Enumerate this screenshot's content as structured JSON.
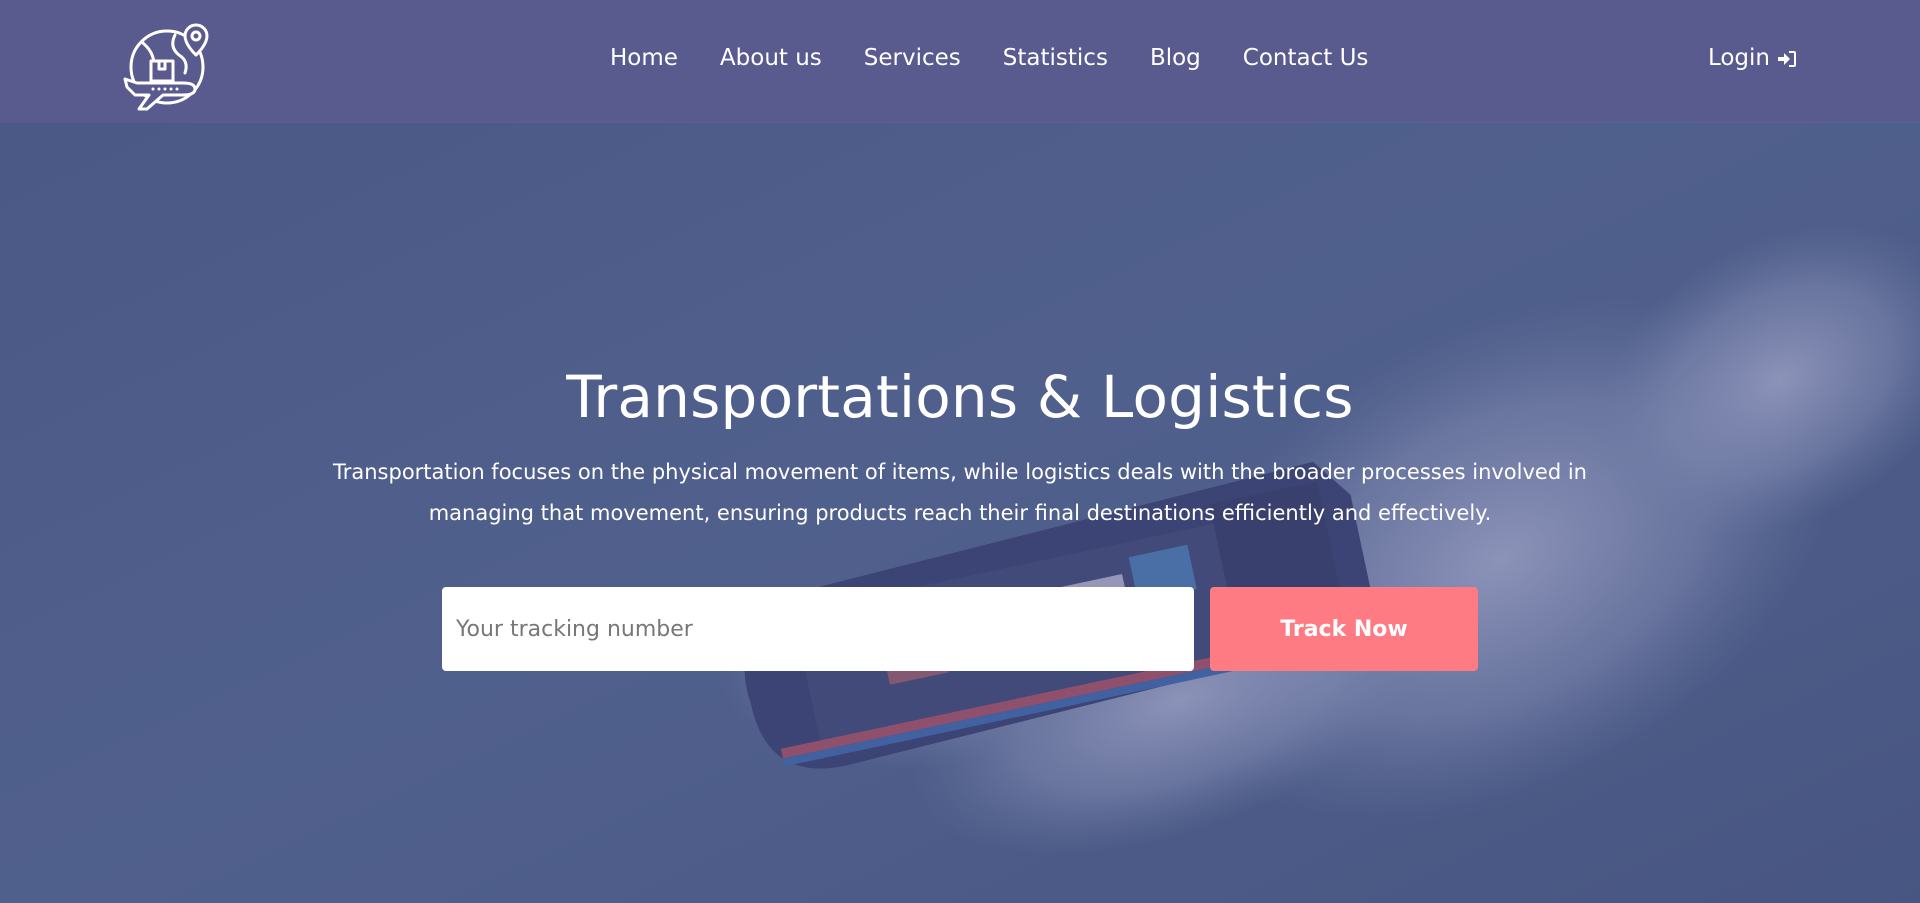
{
  "theme": {
    "navbar_bg": "#5a5a8e",
    "overlay": "#545592",
    "accent": "#fe7b84",
    "text": "#ffffff"
  },
  "header": {
    "logo_icon": "globe-plane-location-icon",
    "nav": [
      {
        "label": "Home"
      },
      {
        "label": "About us"
      },
      {
        "label": "Services"
      },
      {
        "label": "Statistics"
      },
      {
        "label": "Blog"
      },
      {
        "label": "Contact Us"
      }
    ],
    "login": {
      "label": "Login",
      "icon": "sign-in-icon"
    }
  },
  "hero": {
    "title": "Transportations & Logistics",
    "description": "Transportation focuses on the physical movement of items, while logistics deals with the broader processes involved in managing that movement, ensuring products reach their final destinations efficiently and effectively.",
    "tracking": {
      "placeholder": "Your tracking number",
      "value": "",
      "button_label": "Track Now"
    },
    "background": "aerial-view-ship-on-sea"
  }
}
